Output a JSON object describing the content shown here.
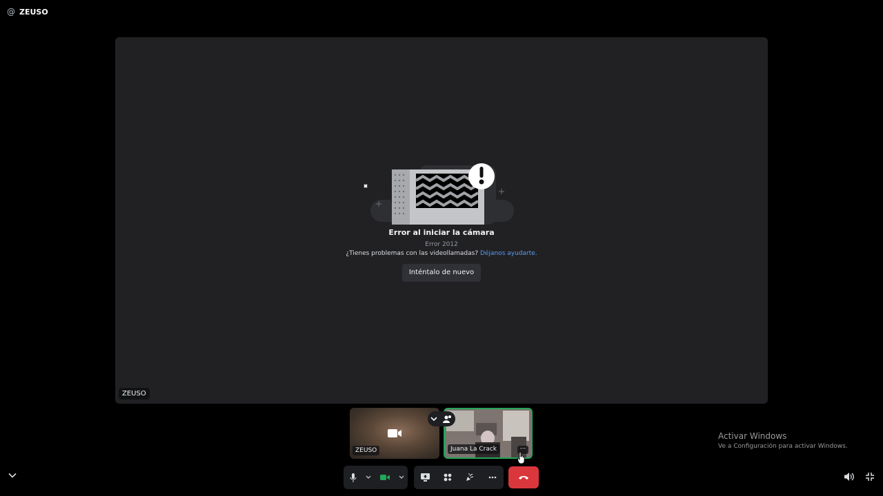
{
  "header": {
    "at_symbol": "@",
    "channel_name": "ZEUSO"
  },
  "stage": {
    "error_title": "Error al iniciar la cámara",
    "error_code": "Error 2012",
    "help_text": "¿Tienes problemas con las videollamadas?",
    "help_link": "Déjanos ayudarte.",
    "retry_label": "Inténtalo de nuevo",
    "name_tag": "ZEUSO"
  },
  "tiles": [
    {
      "name": "ZEUSO",
      "camera": "off"
    },
    {
      "name": "Juana La Crack",
      "speaking": true
    }
  ],
  "controls": {
    "icons": [
      "microphone-icon",
      "chevron-down-icon",
      "camera-icon",
      "chevron-down-icon",
      "screen-share-icon",
      "activities-icon",
      "soundboard-icon",
      "more-icon",
      "hang-up-icon"
    ],
    "camera_color": "#23a55a",
    "hangup_color": "#da373c"
  },
  "watermark": {
    "line1": "Activar Windows",
    "line2": "Ve a Configuración para activar Windows."
  }
}
